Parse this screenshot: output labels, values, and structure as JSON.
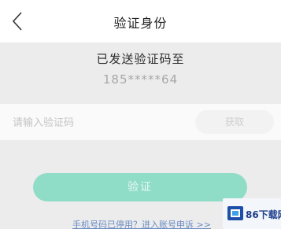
{
  "header": {
    "title": "验证身份",
    "back_icon": "chevron-left-icon"
  },
  "verification": {
    "sent_label": "已发送验证码至",
    "phone_masked": "185*****64"
  },
  "code_field": {
    "placeholder": "请输入验证码",
    "value": "",
    "resend_label": "获取"
  },
  "submit": {
    "label": "验证"
  },
  "footer": {
    "link_text": "手机号码已停用？进入账号申诉 >>"
  },
  "watermark": {
    "text": "86下载网",
    "logo_icon": "box-logo-icon"
  },
  "colors": {
    "accent": "#8fdcc7",
    "link": "#6b8cc4",
    "background": "#ececec"
  }
}
